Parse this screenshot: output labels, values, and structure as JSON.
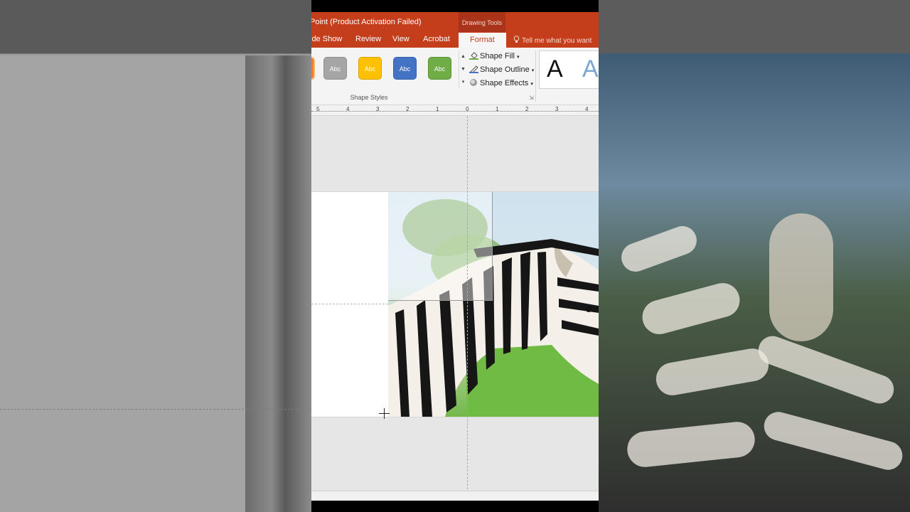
{
  "window": {
    "title": "Point (Product Activation Failed)",
    "context_tab_group": "Drawing Tools"
  },
  "tabs": [
    {
      "label": "ide Show",
      "active": false
    },
    {
      "label": "Review",
      "active": false
    },
    {
      "label": "View",
      "active": false
    },
    {
      "label": "Acrobat",
      "active": false
    },
    {
      "label": "Format",
      "active": true
    }
  ],
  "tell_me": {
    "label": "Tell me what you want"
  },
  "ribbon": {
    "shape_style_swatches": [
      {
        "label": "Abc",
        "color": "#a5a5a5"
      },
      {
        "label": "Abc",
        "color": "#ffc000"
      },
      {
        "label": "Abc",
        "color": "#4472c4"
      },
      {
        "label": "Abc",
        "color": "#70ad47"
      }
    ],
    "shape_fill": "Shape Fill",
    "shape_outline": "Shape Outline",
    "shape_effects": "Shape Effects",
    "group_label": "Shape Styles",
    "wordart_samples": [
      "A",
      "A"
    ]
  },
  "ruler": {
    "numbers": [
      "5",
      "4",
      "3",
      "2",
      "1",
      "0",
      "1",
      "2",
      "3",
      "4"
    ]
  },
  "colors": {
    "accent": "#c43e1c",
    "accent_dark": "#a9341a",
    "ribbon_bg": "#f4f4f4"
  }
}
